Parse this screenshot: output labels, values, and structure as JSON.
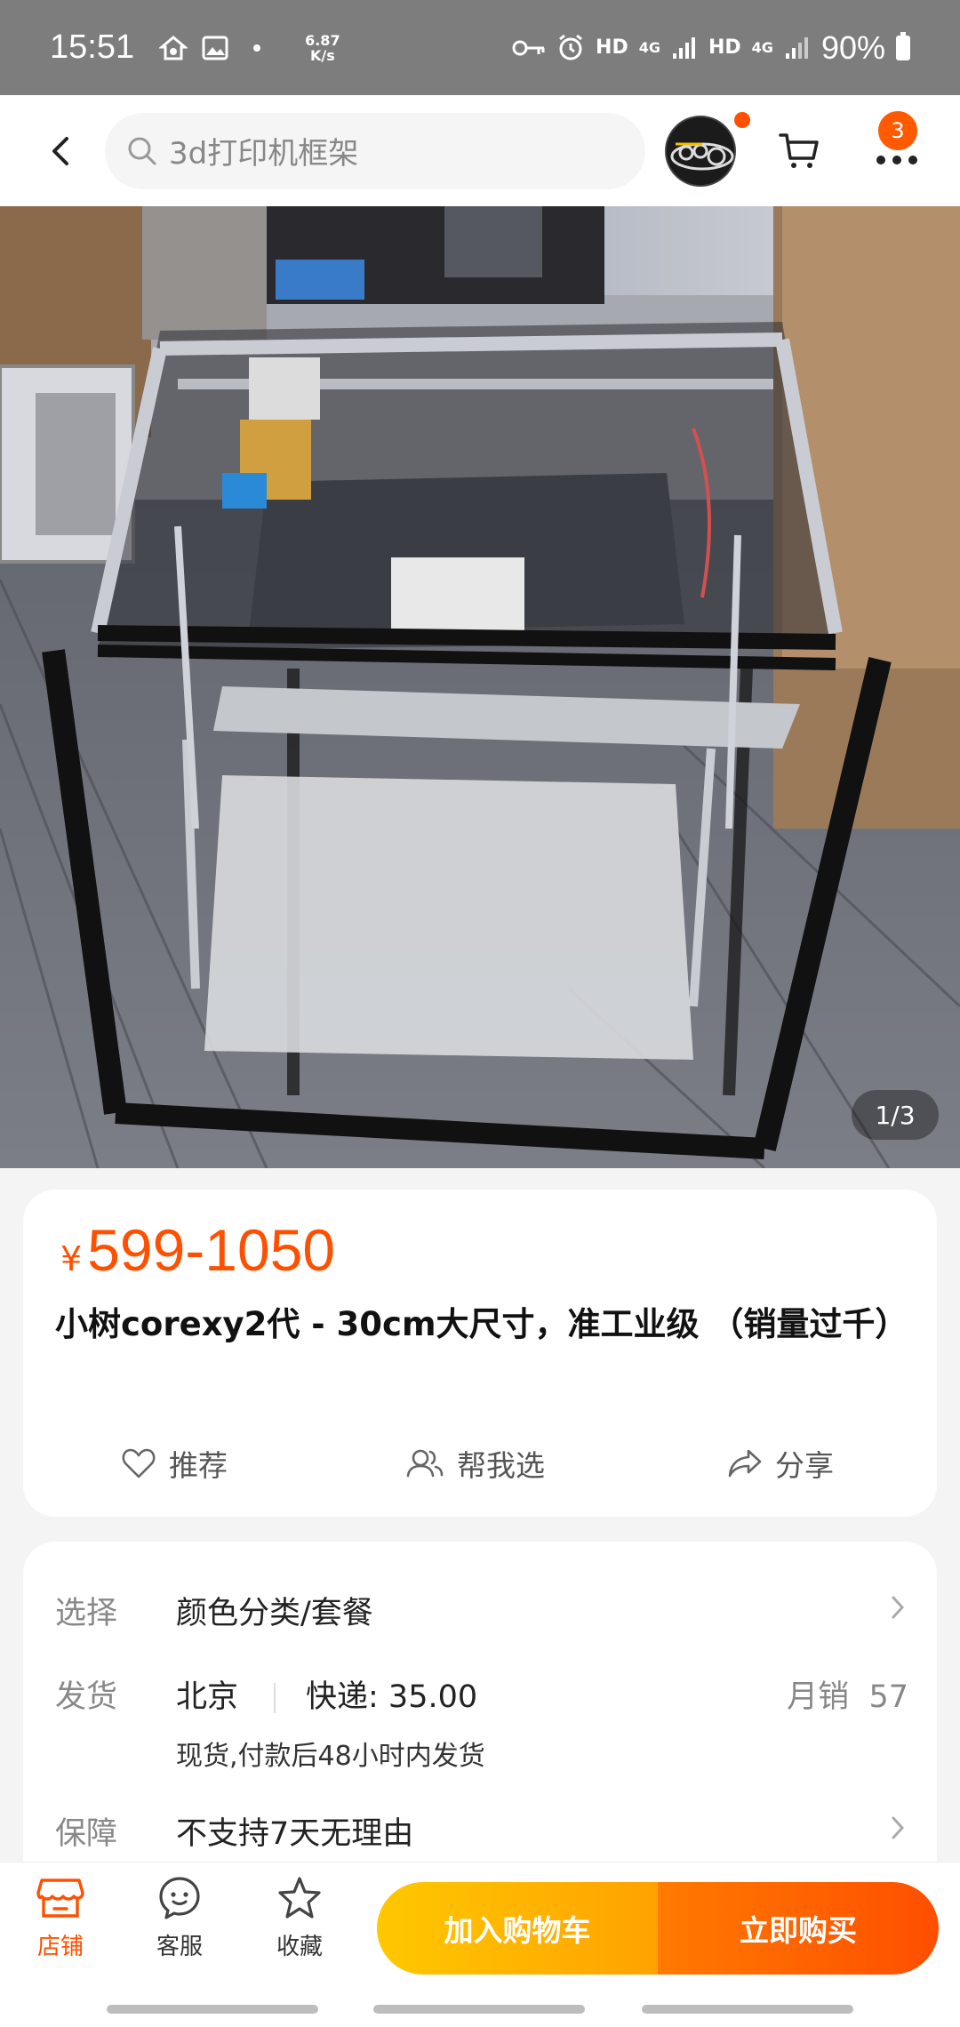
{
  "status_bar": {
    "time": "15:51",
    "speed_value": "6.87",
    "speed_unit": "K/s",
    "net1": "HD",
    "net1_gen": "4G",
    "net2": "HD",
    "net2_gen": "4G",
    "battery": "90%"
  },
  "header": {
    "search_placeholder": "3d打印机框架",
    "cart_badge": "3"
  },
  "gallery": {
    "counter": "1/3"
  },
  "product": {
    "currency": "¥",
    "price": "599-1050",
    "title": "小树corexy2代 - 30cm大尺寸，准工业级 （销量过千）",
    "actions": {
      "recommend": "推荐",
      "help_choose": "帮我选",
      "share": "分享"
    }
  },
  "info": {
    "select_label": "选择",
    "select_value": "颜色分类/套餐",
    "ship_label": "发货",
    "ship_from": "北京",
    "express": "快递:  35.00",
    "monthly_sales_label": "月销",
    "monthly_sales": "57",
    "ship_note": "现货,付款后48小时内发货",
    "guarantee_label": "保障",
    "guarantee_value": "不支持7天无理由"
  },
  "bottom_bar": {
    "store": "店铺",
    "service": "客服",
    "favorite": "收藏",
    "add_to_cart": "加入购物车",
    "buy_now": "立即购买"
  },
  "colors": {
    "accent": "#ff5000",
    "cart_button": "#ffb400",
    "buy_button": "#ff5a00"
  }
}
